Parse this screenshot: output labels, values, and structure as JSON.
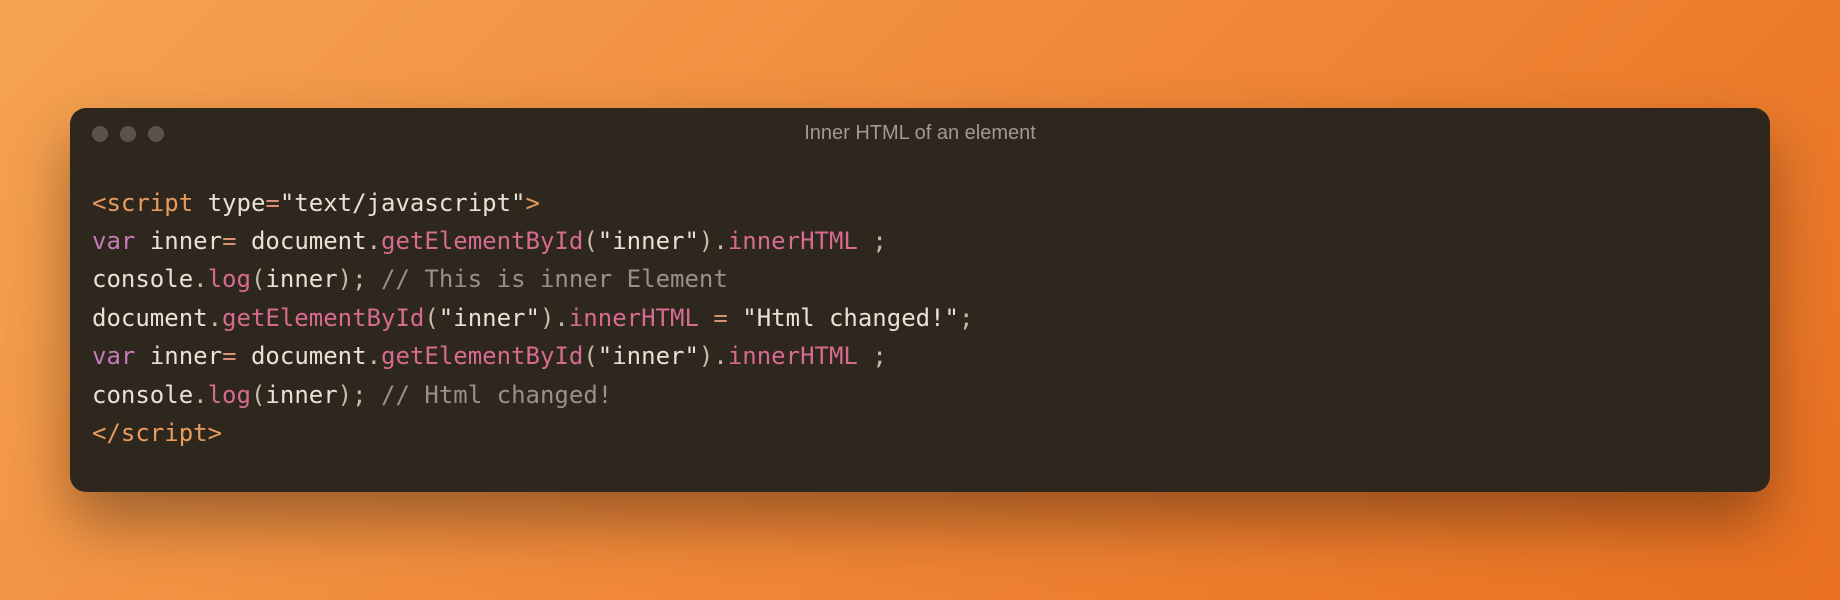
{
  "window": {
    "title": "Inner HTML of an element"
  },
  "code": {
    "line1": {
      "open": "<",
      "tag": "script",
      "sp": " ",
      "attr": "type",
      "eq": "=",
      "val": "\"text/javascript\"",
      "close": ">"
    },
    "line2": {
      "kw": "var",
      "sp": " ",
      "id": "inner",
      "eq": "= ",
      "doc": "document",
      "dot1": ".",
      "m": "getElementById",
      "lp": "(",
      "arg": "\"inner\"",
      "rp": ")",
      "dot2": ".",
      "prop": "innerHTML",
      "sp2": " ",
      "semi": ";"
    },
    "line3": {
      "con": "console",
      "dot": ".",
      "log": "log",
      "lp": "(",
      "arg": "inner",
      "rp": ")",
      "semi": ";",
      "sp": " ",
      "comment": "// This is inner Element"
    },
    "line4": {
      "doc": "document",
      "dot1": ".",
      "m": "getElementById",
      "lp": "(",
      "arg": "\"inner\"",
      "rp": ")",
      "dot2": ".",
      "prop": "innerHTML",
      "sp": " ",
      "eq": "=",
      "sp2": " ",
      "val": "\"Html changed!\"",
      "semi": ";"
    },
    "line5": {
      "kw": "var",
      "sp": " ",
      "id": "inner",
      "eq": "= ",
      "doc": "document",
      "dot1": ".",
      "m": "getElementById",
      "lp": "(",
      "arg": "\"inner\"",
      "rp": ")",
      "dot2": ".",
      "prop": "innerHTML",
      "sp2": " ",
      "semi": ";"
    },
    "line6": {
      "con": "console",
      "dot": ".",
      "log": "log",
      "lp": "(",
      "arg": "inner",
      "rp": ")",
      "semi": ";",
      "sp": " ",
      "comment": "// Html changed!"
    },
    "line7": {
      "open": "</",
      "tag": "script",
      "close": ">"
    }
  }
}
